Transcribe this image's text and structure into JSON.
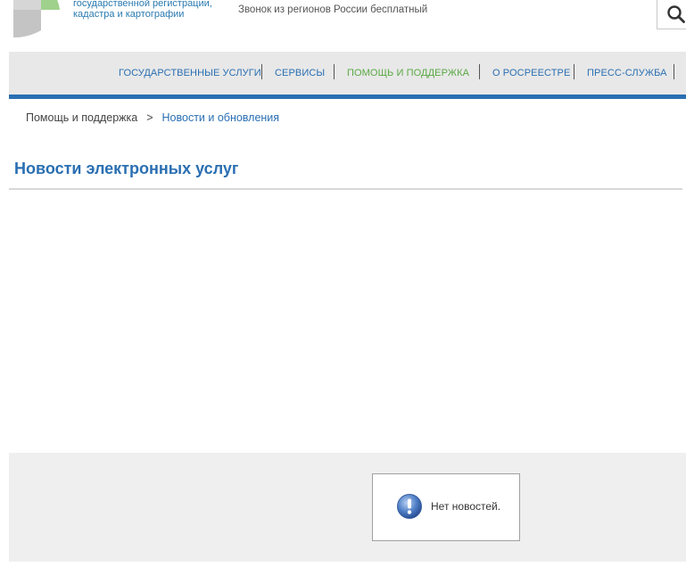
{
  "header": {
    "org_name_line1": "государственной регистрации,",
    "org_name_line2": "кадастра и картографии",
    "free_call_text": "Звонок из регионов России бесплатный",
    "brand_green": "#5aa844",
    "brand_blue": "#2a6fb2",
    "search_icon": "search-icon"
  },
  "nav": {
    "items": [
      {
        "label": "ГОСУДАРСТВЕННЫЕ УСЛУГИ",
        "active": false
      },
      {
        "label": "СЕРВИСЫ",
        "active": false
      },
      {
        "label": "ПОМОЩЬ И ПОДДЕРЖКА",
        "active": true
      },
      {
        "label": "О РОСРЕЕСТРЕ",
        "active": false
      },
      {
        "label": "ПРЕСС-СЛУЖБА",
        "active": false
      }
    ]
  },
  "breadcrumb": {
    "parent": "Помощь и поддержка",
    "separator": ">",
    "current": "Новости и обновления"
  },
  "page": {
    "title": "Новости электронных услуг"
  },
  "notice": {
    "icon": "info-exclamation-icon",
    "text": "Нет новостей."
  }
}
